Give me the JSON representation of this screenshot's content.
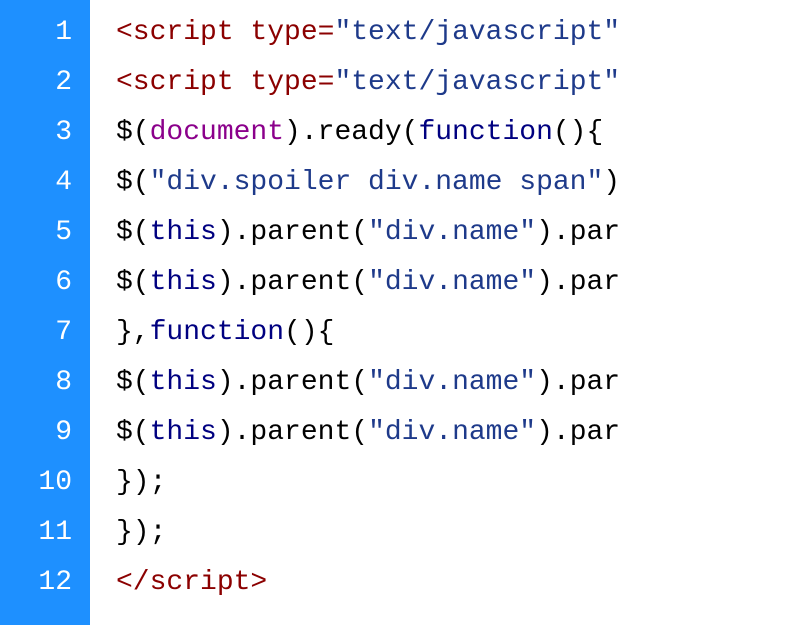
{
  "gutter": {
    "lines": [
      "1",
      "2",
      "3",
      "4",
      "5",
      "6",
      "7",
      "8",
      "9",
      "10",
      "11",
      "12"
    ]
  },
  "code": {
    "lines": [
      {
        "tokens": [
          {
            "cls": "tag",
            "t": "<script "
          },
          {
            "cls": "attr",
            "t": "type"
          },
          {
            "cls": "tag",
            "t": "="
          },
          {
            "cls": "string",
            "t": "\"text/javascript\""
          }
        ]
      },
      {
        "tokens": [
          {
            "cls": "tag",
            "t": "<script "
          },
          {
            "cls": "attr",
            "t": "type"
          },
          {
            "cls": "tag",
            "t": "="
          },
          {
            "cls": "string",
            "t": "\"text/javascript\""
          }
        ]
      },
      {
        "tokens": [
          {
            "cls": "punct",
            "t": "$("
          },
          {
            "cls": "ident",
            "t": "document"
          },
          {
            "cls": "punct",
            "t": ").ready("
          },
          {
            "cls": "keyword",
            "t": "function"
          },
          {
            "cls": "punct",
            "t": "(){"
          }
        ]
      },
      {
        "tokens": [
          {
            "cls": "punct",
            "t": "$("
          },
          {
            "cls": "string",
            "t": "\"div.spoiler div.name span\""
          },
          {
            "cls": "punct",
            "t": ")"
          }
        ]
      },
      {
        "tokens": [
          {
            "cls": "punct",
            "t": "$("
          },
          {
            "cls": "this",
            "t": "this"
          },
          {
            "cls": "punct",
            "t": ").parent("
          },
          {
            "cls": "string",
            "t": "\"div.name\""
          },
          {
            "cls": "punct",
            "t": ").par"
          }
        ]
      },
      {
        "tokens": [
          {
            "cls": "punct",
            "t": "$("
          },
          {
            "cls": "this",
            "t": "this"
          },
          {
            "cls": "punct",
            "t": ").parent("
          },
          {
            "cls": "string",
            "t": "\"div.name\""
          },
          {
            "cls": "punct",
            "t": ").par"
          }
        ]
      },
      {
        "tokens": [
          {
            "cls": "punct",
            "t": "},"
          },
          {
            "cls": "keyword",
            "t": "function"
          },
          {
            "cls": "punct",
            "t": "(){"
          }
        ]
      },
      {
        "tokens": [
          {
            "cls": "punct",
            "t": "$("
          },
          {
            "cls": "this",
            "t": "this"
          },
          {
            "cls": "punct",
            "t": ").parent("
          },
          {
            "cls": "string",
            "t": "\"div.name\""
          },
          {
            "cls": "punct",
            "t": ").par"
          }
        ]
      },
      {
        "tokens": [
          {
            "cls": "punct",
            "t": "$("
          },
          {
            "cls": "this",
            "t": "this"
          },
          {
            "cls": "punct",
            "t": ").parent("
          },
          {
            "cls": "string",
            "t": "\"div.name\""
          },
          {
            "cls": "punct",
            "t": ").par"
          }
        ]
      },
      {
        "tokens": [
          {
            "cls": "punct",
            "t": "});"
          }
        ]
      },
      {
        "tokens": [
          {
            "cls": "punct",
            "t": "});"
          }
        ]
      },
      {
        "tokens": [
          {
            "cls": "tag",
            "t": "</script>"
          }
        ]
      }
    ]
  }
}
